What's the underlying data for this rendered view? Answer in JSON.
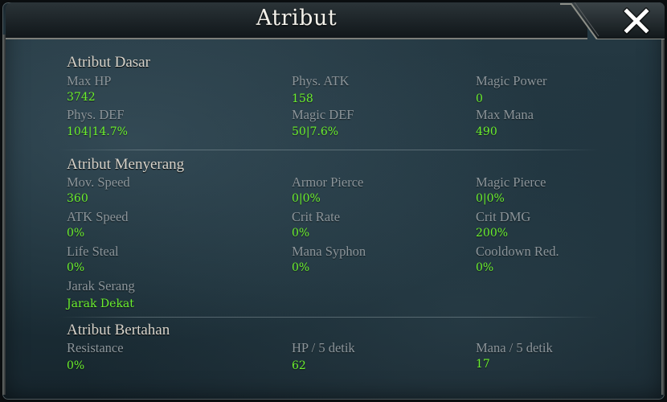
{
  "window": {
    "title": "Atribut",
    "close_icon": "close-icon"
  },
  "colors": {
    "value": "#6cf02d",
    "label": "#8c959a",
    "heading": "#d8d4cb"
  },
  "sections": {
    "dasar": {
      "title": "Atribut Dasar",
      "stats": [
        {
          "label": "Max HP",
          "value": "3742"
        },
        {
          "label": "Phys. ATK",
          "value": "158"
        },
        {
          "label": "Magic Power",
          "value": "0"
        },
        {
          "label": "Phys. DEF",
          "value": "104|14.7%"
        },
        {
          "label": "Magic DEF",
          "value": "50|7.6%"
        },
        {
          "label": "Max Mana",
          "value": "490"
        }
      ]
    },
    "menyerang": {
      "title": "Atribut Menyerang",
      "stats": [
        {
          "label": "Mov. Speed",
          "value": "360"
        },
        {
          "label": "Armor Pierce",
          "value": "0|0%"
        },
        {
          "label": "Magic Pierce",
          "value": "0|0%"
        },
        {
          "label": "ATK Speed",
          "value": "0%"
        },
        {
          "label": "Crit Rate",
          "value": "0%"
        },
        {
          "label": "Crit DMG",
          "value": "200%"
        },
        {
          "label": "Life Steal",
          "value": "0%"
        },
        {
          "label": "Mana Syphon",
          "value": "0%"
        },
        {
          "label": "Cooldown Red.",
          "value": "0%"
        },
        {
          "label": "Jarak Serang",
          "value": "Jarak Dekat"
        }
      ]
    },
    "bertahan": {
      "title": "Atribut Bertahan",
      "stats": [
        {
          "label": "Resistance",
          "value": "0%"
        },
        {
          "label": "HP / 5 detik",
          "value": "62"
        },
        {
          "label": "Mana / 5 detik",
          "value": "17"
        }
      ]
    }
  }
}
